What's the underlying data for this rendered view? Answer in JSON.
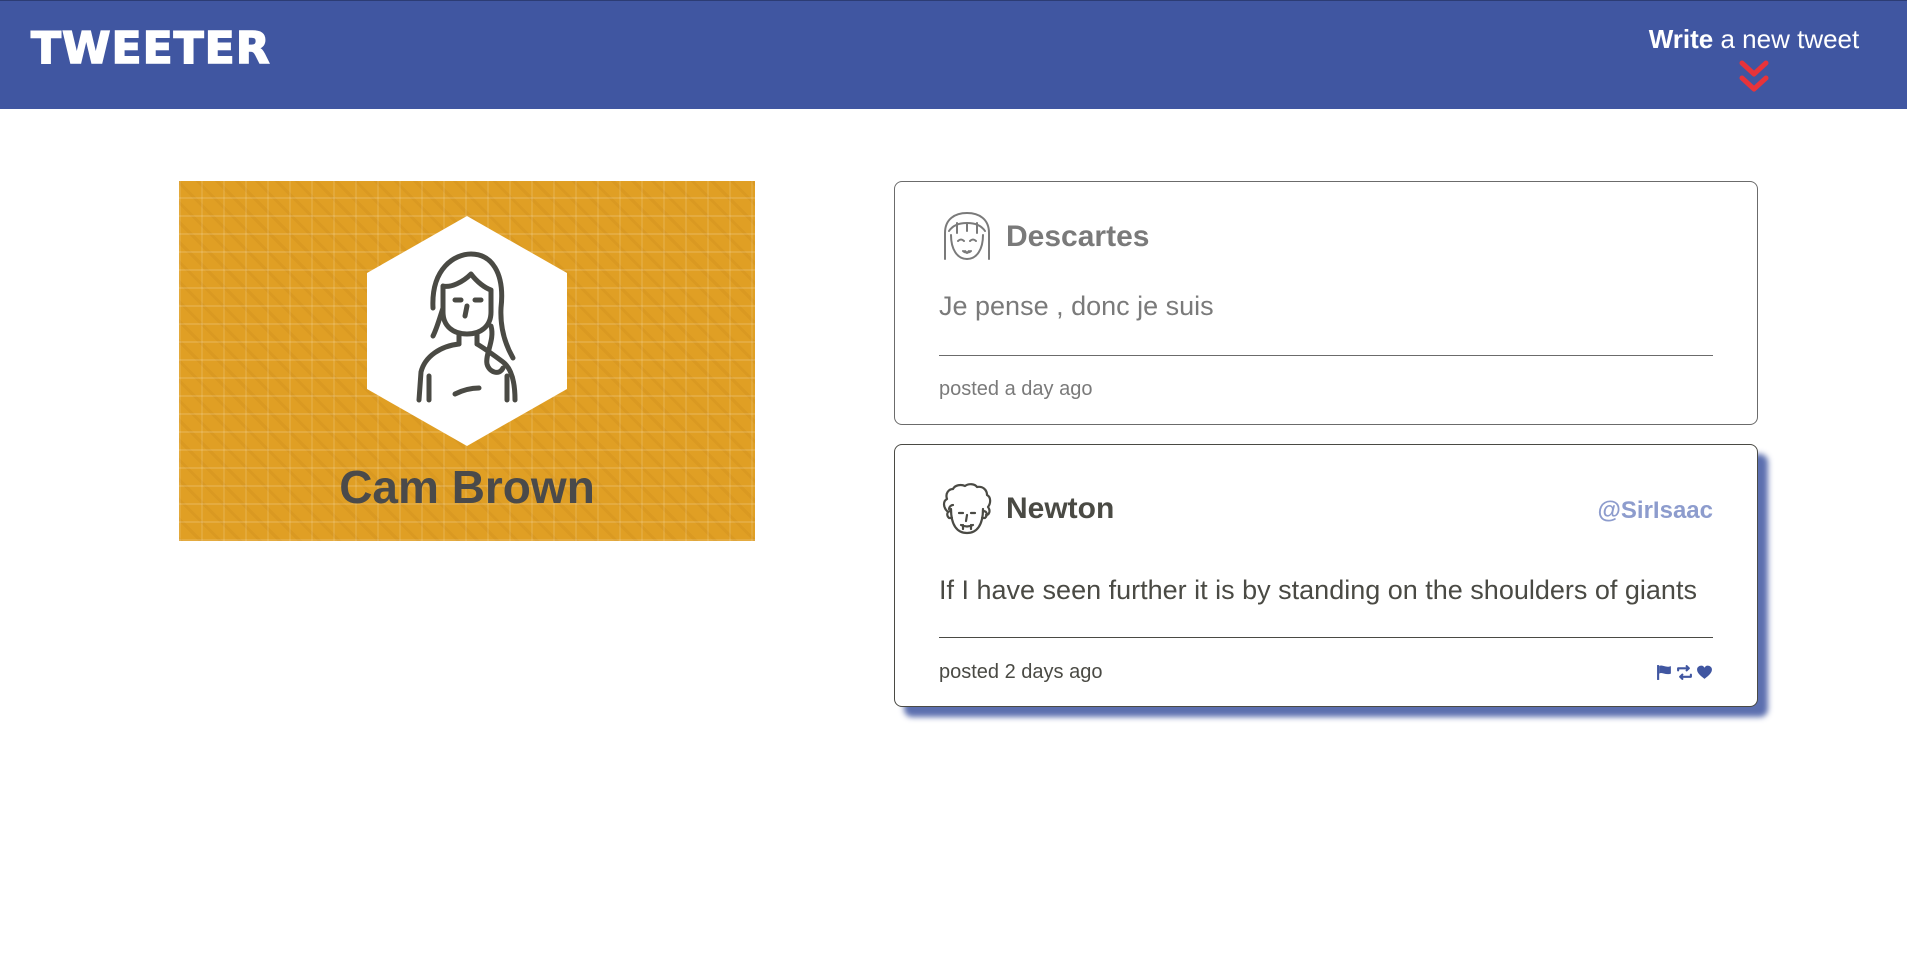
{
  "header": {
    "brand": "TWEETER",
    "compose_strong": "Write",
    "compose_rest": " a new tweet",
    "chevron_icon": "double-chevron-down-icon",
    "background_color": "#4056a1",
    "chevron_color": "#e8333a"
  },
  "profile": {
    "name": "Cam Brown",
    "avatar_icon": "woman-avatar-icon",
    "card_color": "#e09f24"
  },
  "tweets": [
    {
      "author": "Descartes",
      "handle": "",
      "avatar_icon": "girl-avatar-icon",
      "text": "Je pense , donc je suis",
      "time": "posted a day ago",
      "hovered": false
    },
    {
      "author": "Newton",
      "handle": "@SirIsaac",
      "avatar_icon": "curly-hair-avatar-icon",
      "text": "If I have seen further it is by standing on the shoulders of giants",
      "time": "posted 2 days ago",
      "hovered": true,
      "actions": [
        "flag-icon",
        "retweet-icon",
        "heart-icon"
      ]
    }
  ],
  "colors": {
    "accent": "#4056a1",
    "handle": "#8d9ccd",
    "text_dark": "#4a4a44",
    "text_muted": "#7a7a7a"
  }
}
